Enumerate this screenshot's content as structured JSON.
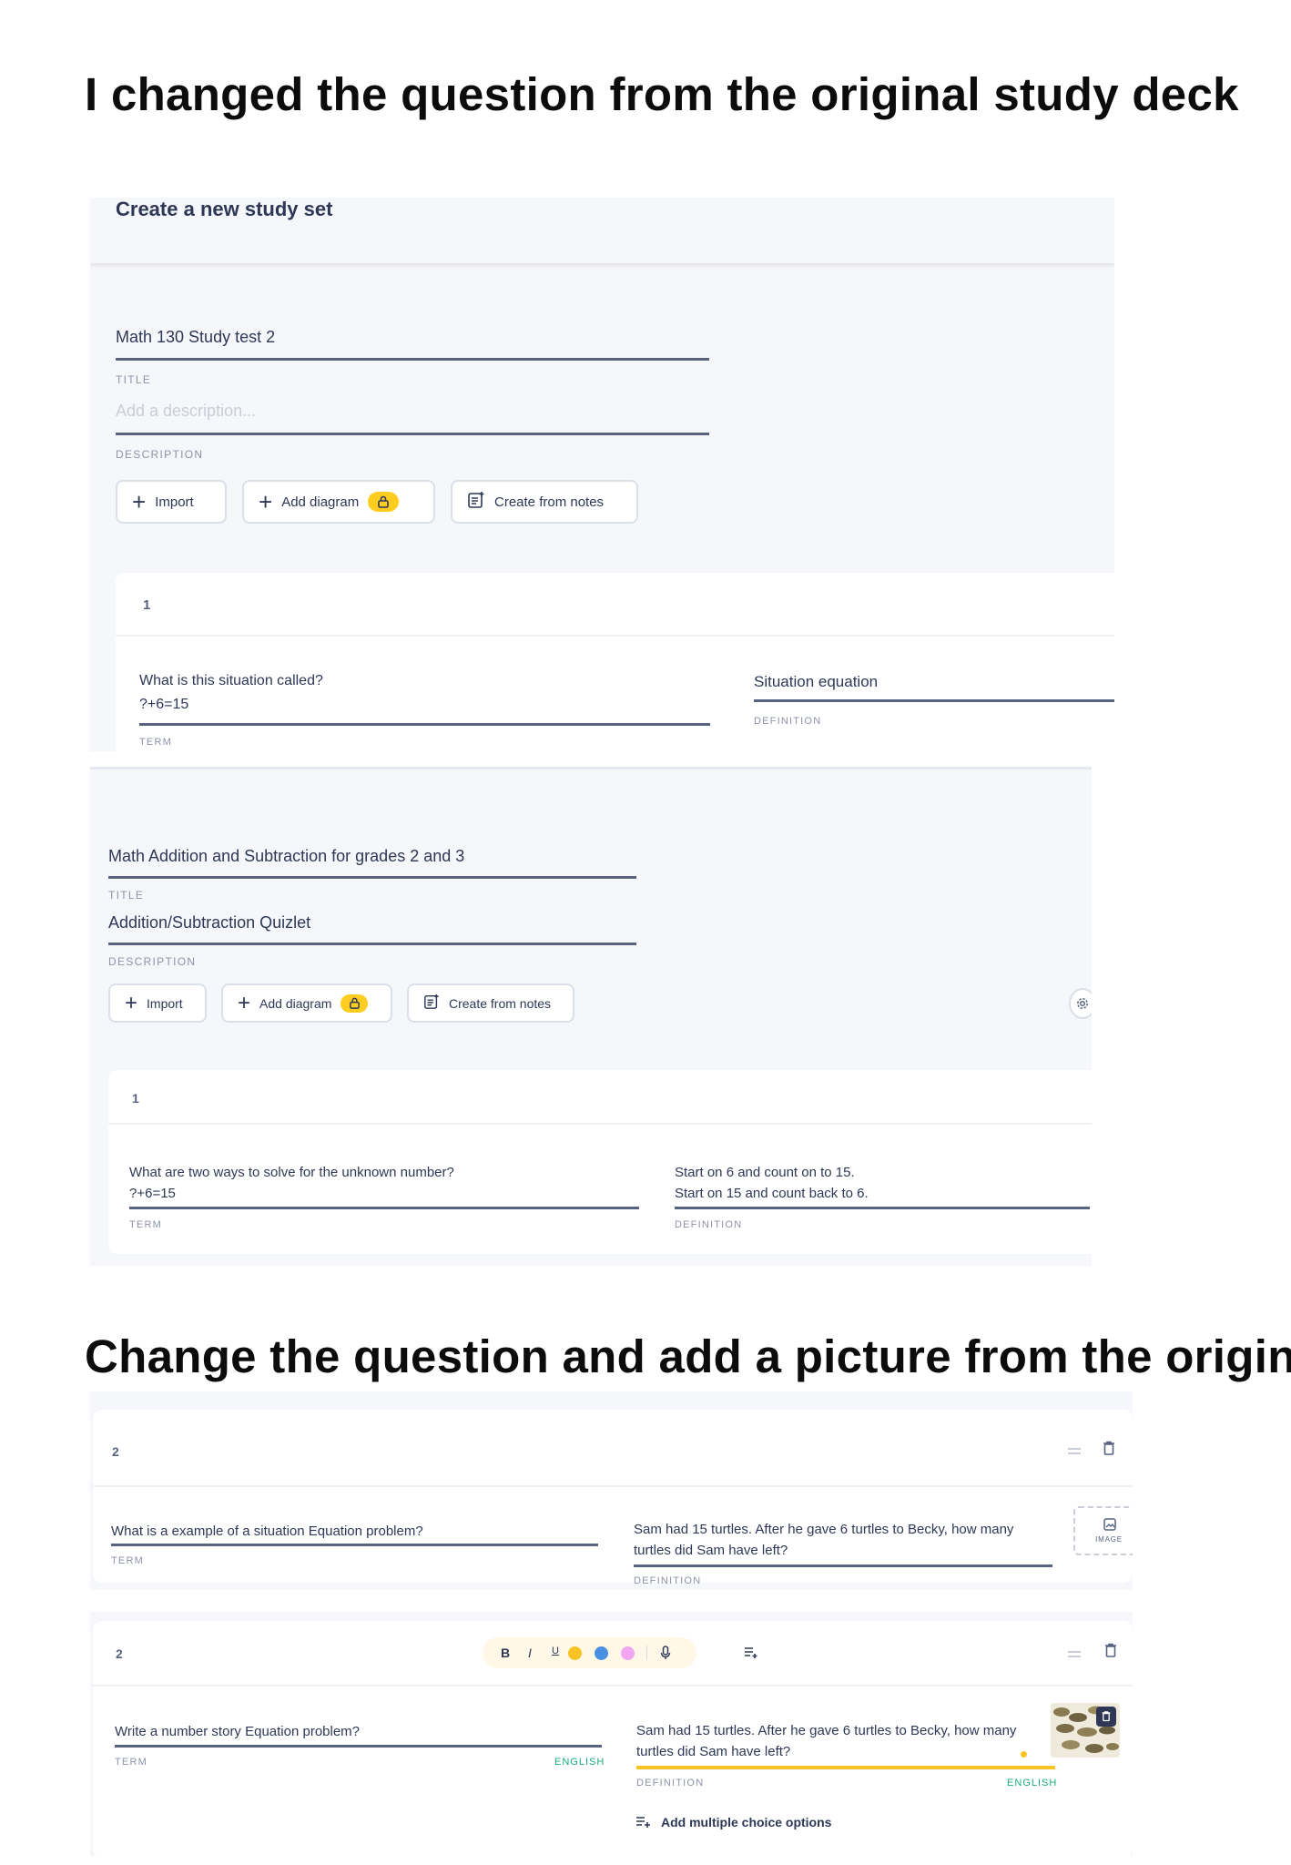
{
  "headings": {
    "first": "I changed the question from the original study deck",
    "second": "Change the question and add a picture from the original"
  },
  "shot1": {
    "header_title": "Create a new study set",
    "title_value": "Math 130 Study test 2",
    "title_label": "TITLE",
    "description_placeholder": "Add a description...",
    "description_label": "DESCRIPTION",
    "buttons": {
      "import": "Import",
      "add_diagram": "Add diagram",
      "create_from_notes": "Create from notes"
    },
    "card": {
      "number": "1",
      "term_line1": "What is this situation called?",
      "term_line2": "?+6=15",
      "term_label": "TERM",
      "definition": "Situation equation",
      "definition_label": "DEFINITION"
    }
  },
  "shot2": {
    "title_value": "Math Addition and Subtraction  for grades 2 and 3",
    "title_label": "TITLE",
    "description_value": "Addition/Subtraction Quizlet",
    "description_label": "DESCRIPTION",
    "buttons": {
      "import": "Import",
      "add_diagram": "Add diagram",
      "create_from_notes": "Create from notes"
    },
    "card": {
      "number": "1",
      "term_line1": "What are two ways to solve for the unknown number?",
      "term_line2": "?+6=15",
      "term_label": "TERM",
      "definition_line1": "Start on 6 and count on to 15.",
      "definition_line2": "Start on 15 and count back to 6.",
      "definition_label": "DEFINITION"
    }
  },
  "shot3": {
    "number": "2",
    "term": "What is a example of a situation Equation problem?",
    "term_label": "TERM",
    "definition_line1": "Sam had 15 turtles. After he gave 6 turtles to Becky, how many",
    "definition_line2": "turtles did Sam have left?",
    "definition_label": "DEFINITION",
    "image_label": "IMAGE"
  },
  "shot4": {
    "number": "2",
    "toolbar": {
      "bold": "B",
      "italic": "I",
      "underline": "U"
    },
    "highlight_colors": [
      "#f7c325",
      "#4a90e2",
      "#f0a6f0"
    ],
    "term": "Write a number story Equation problem?",
    "term_label": "TERM",
    "term_language": "ENGLISH",
    "definition_line1": "Sam had 15 turtles. After he gave 6 turtles to Becky, how many",
    "definition_line2": "turtles did Sam have left?",
    "definition_label": "DEFINITION",
    "definition_language": "ENGLISH",
    "add_mc_label": "Add multiple choice options"
  }
}
